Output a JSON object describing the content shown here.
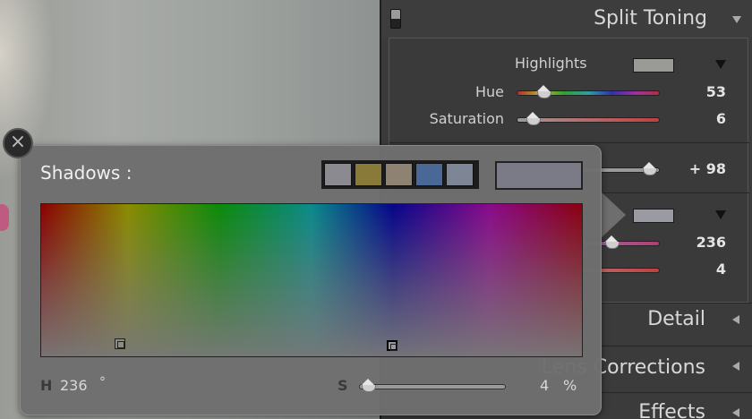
{
  "panel": {
    "title": "Split Toning",
    "highlights": {
      "label": "Highlights",
      "swatch_color": "#9a9a96",
      "hue_label": "Hue",
      "hue_value": "53",
      "saturation_label": "Saturation",
      "saturation_value": "6"
    },
    "balance": {
      "value": "+ 98"
    },
    "shadows": {
      "swatch_color": "#9a9aa2",
      "hue_value": "236",
      "saturation_value": "4"
    },
    "sections": [
      "Detail",
      "Lens Corrections",
      "Effects"
    ]
  },
  "popup": {
    "title": "Shadows :",
    "presets": [
      "#8a8a90",
      "#8a7a3a",
      "#8e8272",
      "#4a6896",
      "#7e8696"
    ],
    "current_color": "#7a7b86",
    "h_label": "H",
    "h_value": "236",
    "h_unit": "°",
    "s_label": "S",
    "s_value": "4",
    "s_unit": "%"
  }
}
